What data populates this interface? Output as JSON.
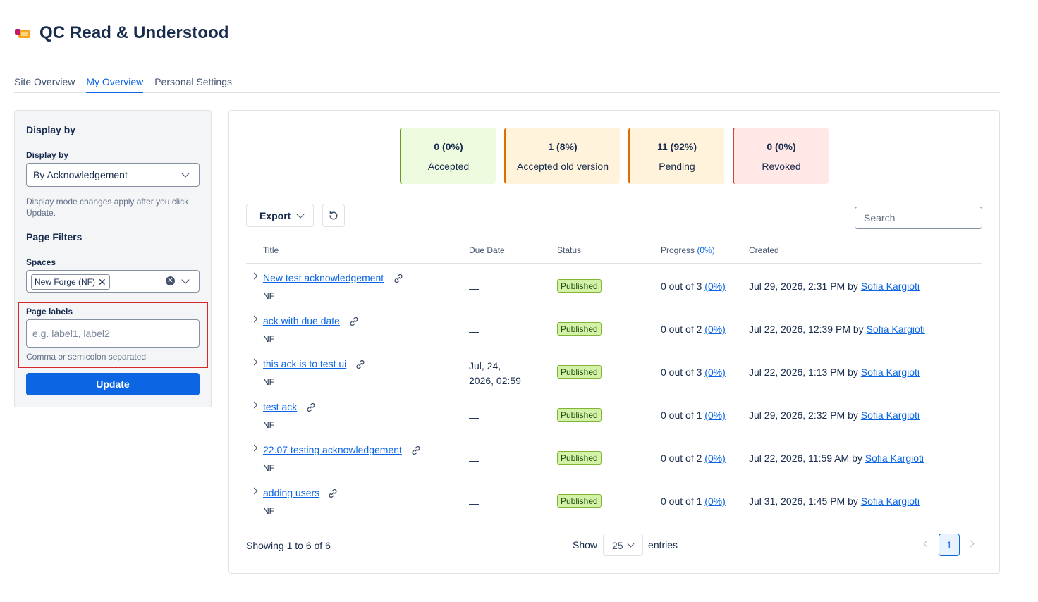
{
  "app": {
    "title": "QC Read & Understood",
    "logo_icon": "app-logo-icon"
  },
  "tabs": [
    {
      "label": "Site Overview",
      "active": false
    },
    {
      "label": "My Overview",
      "active": true
    },
    {
      "label": "Personal Settings",
      "active": false
    }
  ],
  "sidebar": {
    "display_section_title": "Display by",
    "display_by_label": "Display by",
    "display_by_value": "By Acknowledgement",
    "display_help": "Display mode changes apply after you click Update.",
    "filters_title": "Page Filters",
    "spaces_label": "Spaces",
    "spaces_tag": "New Forge (NF)",
    "page_labels_label": "Page labels",
    "page_labels_placeholder": "e.g. label1, label2",
    "page_labels_value": "",
    "page_labels_help": "Comma or semicolon separated",
    "update_label": "Update"
  },
  "stats": [
    {
      "value": "0 (0%)",
      "label": "Accepted",
      "bg": "#effbdf",
      "border": "#6a9a23"
    },
    {
      "value": "1 (8%)",
      "label": "Accepted old version",
      "bg": "#fff3db",
      "border": "#e06c00"
    },
    {
      "value": "11 (92%)",
      "label": "Pending",
      "bg": "#fff3db",
      "border": "#e06c00"
    },
    {
      "value": "0 (0%)",
      "label": "Revoked",
      "bg": "#ffe8e6",
      "border": "#d04437"
    }
  ],
  "toolbar": {
    "export_label": "Export",
    "search_placeholder": "Search",
    "search_value": ""
  },
  "table": {
    "headers": {
      "title": "Title",
      "due_date": "Due Date",
      "status": "Status",
      "progress": "Progress",
      "progress_pct": "(0%)",
      "created": "Created"
    },
    "rows": [
      {
        "title": "New test acknowledgement",
        "space": "NF",
        "due_date": "—",
        "status": "Published",
        "progress": "0 out of 3",
        "progress_pct": "(0%)",
        "created": "Jul 29, 2026, 2:31 PM by",
        "author": "Sofia Kargioti"
      },
      {
        "title": "ack with due date",
        "space": "NF",
        "due_date": "—",
        "status": "Published",
        "progress": "0 out of 2",
        "progress_pct": "(0%)",
        "created": "Jul 22, 2026, 12:39 PM by",
        "author": "Sofia Kargioti"
      },
      {
        "title": "this ack is to test ui",
        "space": "NF",
        "due_date_line1": "Jul, 24,",
        "due_date_line2": "2026, 02:59",
        "status": "Published",
        "progress": "0 out of 3",
        "progress_pct": "(0%)",
        "created": "Jul 22, 2026, 1:13 PM by",
        "author": "Sofia Kargioti"
      },
      {
        "title": "test ack",
        "space": "NF",
        "due_date": "—",
        "status": "Published",
        "progress": "0 out of 1",
        "progress_pct": "(0%)",
        "created": "Jul 29, 2026, 2:32 PM by",
        "author": "Sofia Kargioti"
      },
      {
        "title": "22.07 testing acknowledgement",
        "space": "NF",
        "due_date": "—",
        "status": "Published",
        "progress": "0 out of 2",
        "progress_pct": "(0%)",
        "created": "Jul 22, 2026, 11:59 AM by",
        "author": "Sofia Kargioti"
      },
      {
        "title": "adding users",
        "space": "NF",
        "due_date": "—",
        "status": "Published",
        "progress": "0 out of 1",
        "progress_pct": "(0%)",
        "created": "Jul 31, 2026, 1:45 PM by",
        "author": "Sofia Kargioti"
      }
    ]
  },
  "footer": {
    "showing": "Showing 1 to 6 of 6",
    "show_label": "Show",
    "entries_value": "25",
    "entries_label": "entries",
    "current_page": "1"
  }
}
